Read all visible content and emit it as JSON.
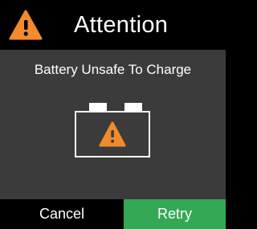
{
  "header": {
    "title": "Attention",
    "icon": "warning-icon",
    "icon_color": "#f28b2b"
  },
  "message": "Battery Unsafe To Charge",
  "battery": {
    "icon": "battery-warning-icon",
    "outline_color": "#ffffff",
    "warning_color": "#f28b2b"
  },
  "buttons": {
    "cancel_label": "Cancel",
    "retry_label": "Retry",
    "retry_color": "#34a853"
  }
}
